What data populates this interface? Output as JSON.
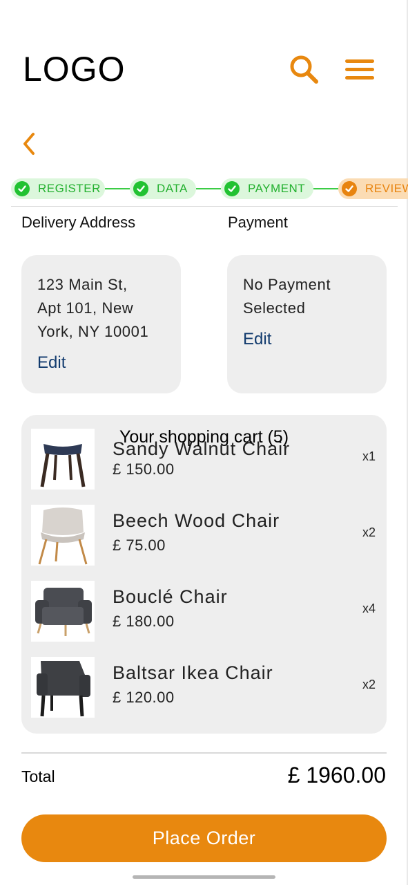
{
  "header": {
    "logo": "LOGO",
    "search_icon": "search-icon",
    "menu_icon": "hamburger-menu-icon",
    "back_icon": "chevron-left-icon"
  },
  "stepper": {
    "steps": [
      {
        "label": "REGISTER",
        "state": "done"
      },
      {
        "label": "DATA",
        "state": "done"
      },
      {
        "label": "PAYMENT",
        "state": "done"
      },
      {
        "label": "REVIEW",
        "state": "active"
      }
    ]
  },
  "delivery": {
    "heading": "Delivery Address",
    "lines": [
      "123 Main St,",
      "Apt 101, New",
      "York, NY 10001"
    ],
    "edit_label": "Edit"
  },
  "payment": {
    "heading": "Payment",
    "lines": [
      "No Payment",
      "Selected"
    ],
    "edit_label": "Edit"
  },
  "cart": {
    "title": "Your shopping cart (5)",
    "items": [
      {
        "name": "Sandy Walnut Chair",
        "price": "£ 150.00",
        "qty": "x1"
      },
      {
        "name": "Beech Wood Chair",
        "price": "£ 75.00",
        "qty": "x2"
      },
      {
        "name": "Bouclé Chair",
        "price": "£ 180.00",
        "qty": "x4"
      },
      {
        "name": "Baltsar Ikea Chair",
        "price": "£ 120.00",
        "qty": "x2"
      }
    ]
  },
  "total": {
    "label": "Total",
    "value": "£ 1960.00"
  },
  "place_order_label": "Place Order",
  "colors": {
    "accent": "#e8880f",
    "success": "#22c232",
    "link": "#123b6e",
    "card_bg": "#eeeeee"
  }
}
